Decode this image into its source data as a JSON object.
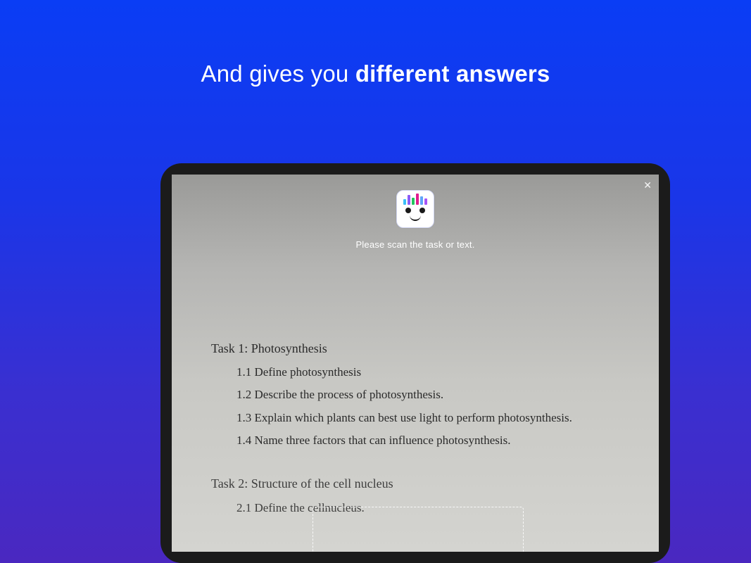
{
  "headline": {
    "prefix": "And gives you ",
    "bold": "different answers"
  },
  "scanner": {
    "instruction": "Please scan the task or text.",
    "close_label": "✕"
  },
  "worksheet": {
    "task1": {
      "title": "Task 1: Photosynthesis",
      "items": [
        "1.1 Define photosynthesis",
        "1.2 Describe the process of photosynthesis.",
        "1.3 Explain which plants can best use light to perform photosynthesis.",
        "1.4 Name three factors that can influence photosynthesis."
      ]
    },
    "task2": {
      "title": "Task 2: Structure of the cell nucleus",
      "items": [
        "2.1 Define the cellnucleus."
      ]
    }
  }
}
